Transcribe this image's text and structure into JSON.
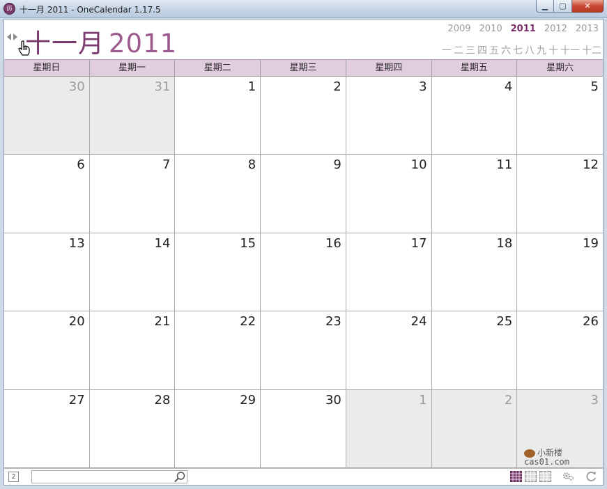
{
  "window": {
    "title": "十一月 2011 - OneCalendar 1.17.5",
    "min_glyph": "▁",
    "max_glyph": "▢",
    "close_glyph": "✕"
  },
  "header": {
    "month": "十一月",
    "year": "2011",
    "years": [
      "2009",
      "2010",
      "2011",
      "2012",
      "2013"
    ],
    "active_year": "2011",
    "months": [
      "一",
      "二",
      "三",
      "四",
      "五",
      "六",
      "七",
      "八",
      "九",
      "十",
      "十一",
      "十二"
    ]
  },
  "weekdays": [
    "星期日",
    "星期一",
    "星期二",
    "星期三",
    "星期四",
    "星期五",
    "星期六"
  ],
  "days": [
    {
      "n": "30",
      "other": true
    },
    {
      "n": "31",
      "other": true
    },
    {
      "n": "1",
      "other": false
    },
    {
      "n": "2",
      "other": false
    },
    {
      "n": "3",
      "other": false
    },
    {
      "n": "4",
      "other": false
    },
    {
      "n": "5",
      "other": false
    },
    {
      "n": "6",
      "other": false
    },
    {
      "n": "7",
      "other": false
    },
    {
      "n": "8",
      "other": false
    },
    {
      "n": "9",
      "other": false
    },
    {
      "n": "10",
      "other": false
    },
    {
      "n": "11",
      "other": false
    },
    {
      "n": "12",
      "other": false
    },
    {
      "n": "13",
      "other": false
    },
    {
      "n": "14",
      "other": false
    },
    {
      "n": "15",
      "other": false
    },
    {
      "n": "16",
      "other": false
    },
    {
      "n": "17",
      "other": false
    },
    {
      "n": "18",
      "other": false
    },
    {
      "n": "19",
      "other": false
    },
    {
      "n": "20",
      "other": false
    },
    {
      "n": "21",
      "other": false
    },
    {
      "n": "22",
      "other": false
    },
    {
      "n": "23",
      "other": false
    },
    {
      "n": "24",
      "other": false
    },
    {
      "n": "25",
      "other": false
    },
    {
      "n": "26",
      "other": false
    },
    {
      "n": "27",
      "other": false
    },
    {
      "n": "28",
      "other": false
    },
    {
      "n": "29",
      "other": false
    },
    {
      "n": "30",
      "other": false
    },
    {
      "n": "1",
      "other": true
    },
    {
      "n": "2",
      "other": true
    },
    {
      "n": "3",
      "other": true
    }
  ],
  "watermark": {
    "line1": "小新楼",
    "line2": "cas01.com"
  },
  "bottombar": {
    "date_chip": "2",
    "search_value": "",
    "search_placeholder": ""
  },
  "colors": {
    "accent": "#7a3a6e",
    "weekday_bg": "#e2ccdf",
    "other_month_bg": "#ebecea"
  }
}
